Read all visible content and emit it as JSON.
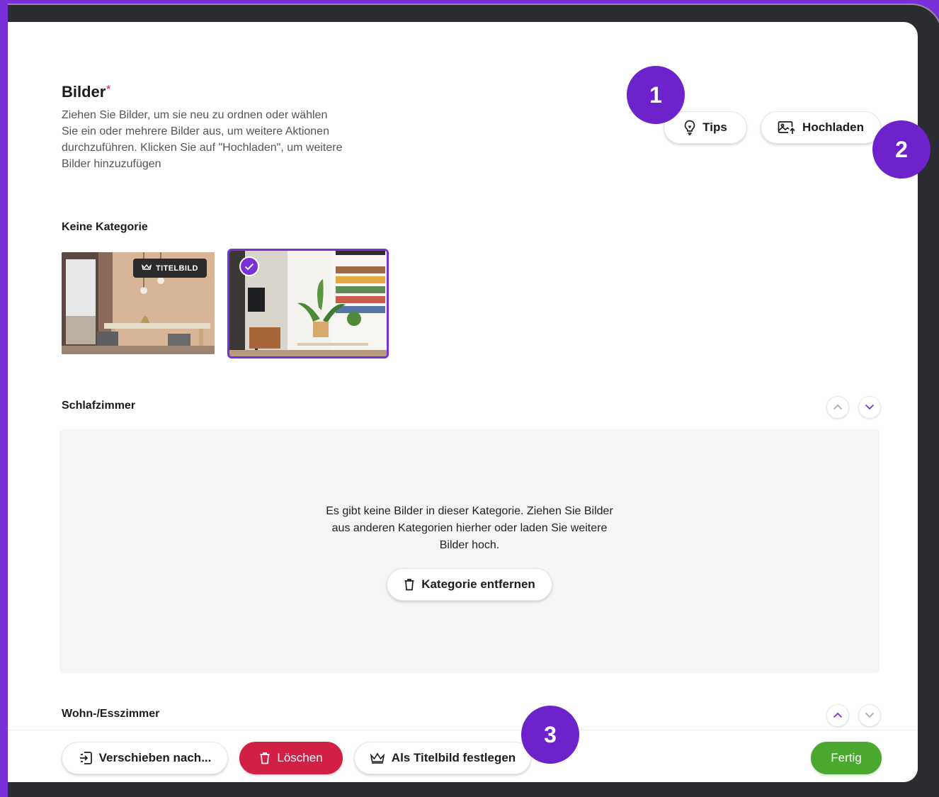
{
  "colors": {
    "accent": "#7a2fd8",
    "danger": "#d11f45",
    "success": "#4aa82e",
    "required": "#e0425a"
  },
  "header": {
    "title": "Bilder",
    "required_mark": "*",
    "description": "Ziehen Sie Bilder, um sie neu zu ordnen oder wählen Sie ein oder mehrere Bilder aus, um weitere Aktionen durchzuführen. Klicken Sie auf \"Hochladen\", um weitere Bilder hinzuzufügen"
  },
  "toolbar": {
    "tips_label": "Tips",
    "tips_icon": "lightbulb-icon",
    "upload_label": "Hochladen",
    "upload_icon": "image-upload-icon"
  },
  "categories": [
    {
      "name": "Keine Kategorie",
      "images": [
        {
          "badge": "TITELBILD",
          "selected": false
        },
        {
          "badge": "",
          "selected": true
        }
      ]
    },
    {
      "name": "Schlafzimmer",
      "empty_message": "Es gibt keine Bilder in dieser Kategorie. Ziehen Sie Bilder aus anderen Kategorien hierher oder laden Sie weitere Bilder hoch.",
      "remove_label": "Kategorie entfernen",
      "remove_icon": "trash-icon"
    },
    {
      "name": "Wohn-/Esszimmer"
    }
  ],
  "actions": {
    "move_label": "Verschieben nach...",
    "move_icon": "move-to-icon",
    "delete_label": "Löschen",
    "delete_icon": "trash-icon",
    "set_cover_label": "Als Titelbild festlegen",
    "set_cover_icon": "crown-icon",
    "done_label": "Fertig"
  },
  "markers": [
    "1",
    "2",
    "3"
  ]
}
